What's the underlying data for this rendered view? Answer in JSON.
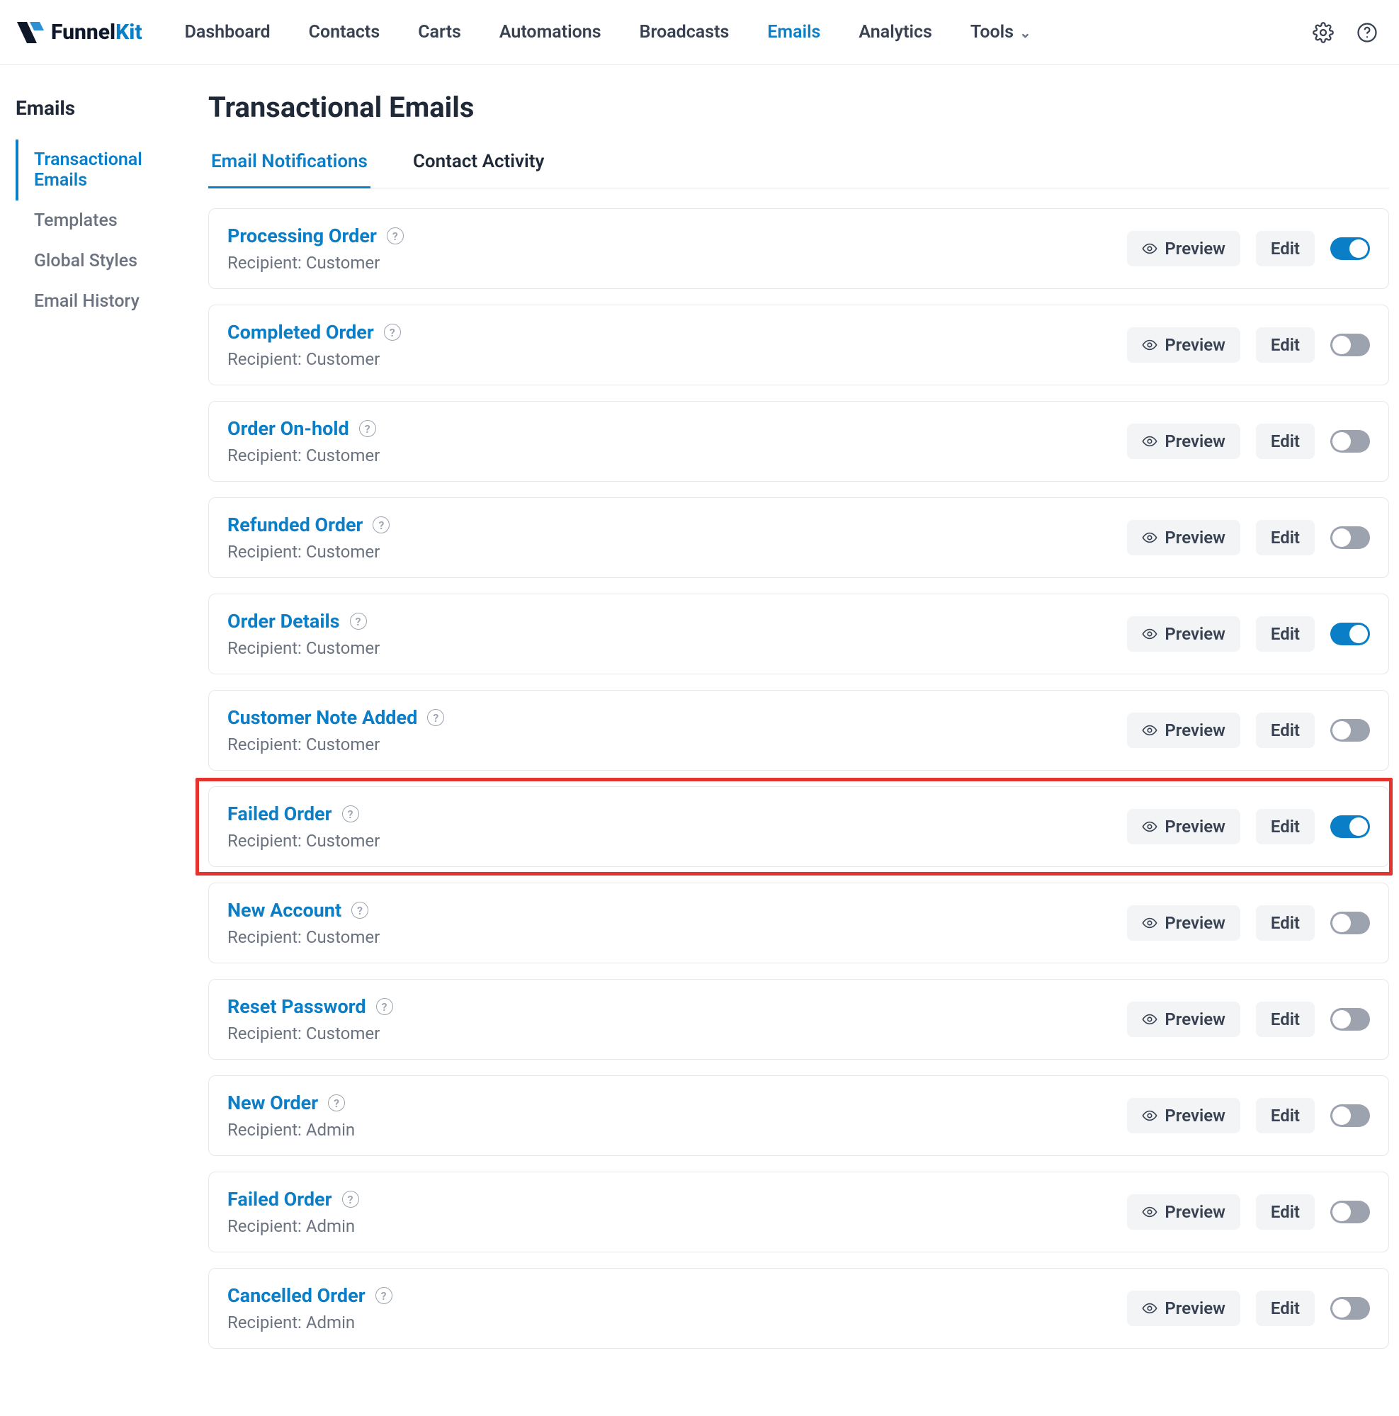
{
  "brand": {
    "name1": "Funnel",
    "name2": "Kit"
  },
  "nav": {
    "items": [
      {
        "label": "Dashboard",
        "active": false
      },
      {
        "label": "Contacts",
        "active": false
      },
      {
        "label": "Carts",
        "active": false
      },
      {
        "label": "Automations",
        "active": false
      },
      {
        "label": "Broadcasts",
        "active": false
      },
      {
        "label": "Emails",
        "active": true
      },
      {
        "label": "Analytics",
        "active": false
      },
      {
        "label": "Tools",
        "active": false,
        "dropdown": true
      }
    ]
  },
  "sidebar": {
    "title": "Emails",
    "items": [
      {
        "label": "Transactional Emails",
        "active": true
      },
      {
        "label": "Templates",
        "active": false
      },
      {
        "label": "Global Styles",
        "active": false
      },
      {
        "label": "Email History",
        "active": false
      }
    ]
  },
  "page": {
    "title": "Transactional Emails"
  },
  "tabs": [
    {
      "label": "Email Notifications",
      "active": true
    },
    {
      "label": "Contact Activity",
      "active": false
    }
  ],
  "recipient_prefix": "Recipient: ",
  "actions": {
    "preview": "Preview",
    "edit": "Edit"
  },
  "rows": [
    {
      "title": "Processing Order",
      "recipient": "Customer",
      "enabled": true,
      "highlight": false
    },
    {
      "title": "Completed Order",
      "recipient": "Customer",
      "enabled": false,
      "highlight": false
    },
    {
      "title": "Order On-hold",
      "recipient": "Customer",
      "enabled": false,
      "highlight": false
    },
    {
      "title": "Refunded Order",
      "recipient": "Customer",
      "enabled": false,
      "highlight": false
    },
    {
      "title": "Order Details",
      "recipient": "Customer",
      "enabled": true,
      "highlight": false
    },
    {
      "title": "Customer Note Added",
      "recipient": "Customer",
      "enabled": false,
      "highlight": false
    },
    {
      "title": "Failed Order",
      "recipient": "Customer",
      "enabled": true,
      "highlight": true
    },
    {
      "title": "New Account",
      "recipient": "Customer",
      "enabled": false,
      "highlight": false
    },
    {
      "title": "Reset Password",
      "recipient": "Customer",
      "enabled": false,
      "highlight": false
    },
    {
      "title": "New Order",
      "recipient": "Admin",
      "enabled": false,
      "highlight": false
    },
    {
      "title": "Failed Order",
      "recipient": "Admin",
      "enabled": false,
      "highlight": false
    },
    {
      "title": "Cancelled Order",
      "recipient": "Admin",
      "enabled": false,
      "highlight": false
    }
  ]
}
